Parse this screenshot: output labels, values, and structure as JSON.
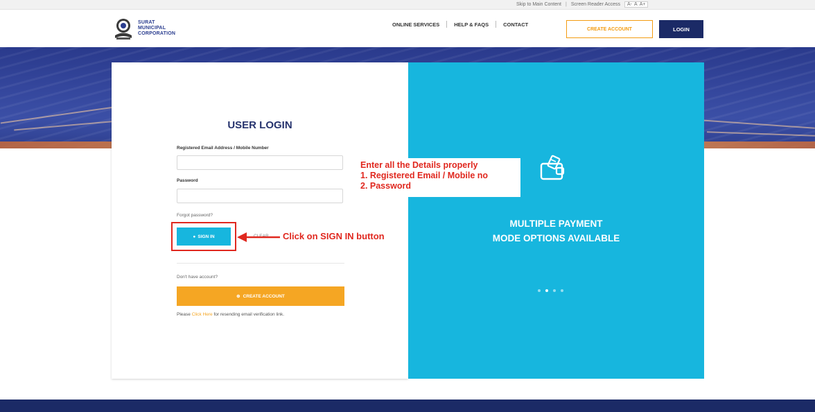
{
  "utility_bar": {
    "skip_link": "Skip to Main Content",
    "screen_reader": "Screen Reader Access",
    "font_sizes": [
      "A-",
      "A",
      "A+"
    ]
  },
  "header": {
    "logo_lines": [
      "SURAT",
      "MUNICIPAL",
      "CORPORATION"
    ],
    "nav": [
      "ONLINE SERVICES",
      "HELP & FAQS",
      "CONTACT"
    ],
    "create_account": "CREATE ACCOUNT",
    "login": "LOGIN",
    "colors": {
      "navy": "#1b2a66",
      "orange": "#f39c12"
    }
  },
  "login_form": {
    "title": "USER LOGIN",
    "email_label": "Registered Email Address / Mobile Number",
    "email_value": "",
    "password_label": "Password",
    "password_value": "",
    "forgot": "Forgot password?",
    "sign_in": "SIGN IN",
    "clear": "CLEAR",
    "no_account": "Don't have account?",
    "create_account": "CREATE ACCOUNT",
    "resend_prefix": "Please",
    "resend_link": "Click Here",
    "resend_suffix": "for resending email verification link."
  },
  "annotations": {
    "details_lines": [
      "Enter all the Details properly",
      "1. Registered Email / Mobile no",
      "2. Password"
    ],
    "signin_note": "Click on SIGN IN button",
    "color": "#e0281f"
  },
  "promo": {
    "line1": "MULTIPLE PAYMENT",
    "line2": "MODE OPTIONS AVAILABLE",
    "icon": "wallet-icon",
    "slides": 4,
    "active_slide": 2,
    "color": "#17b6de"
  }
}
